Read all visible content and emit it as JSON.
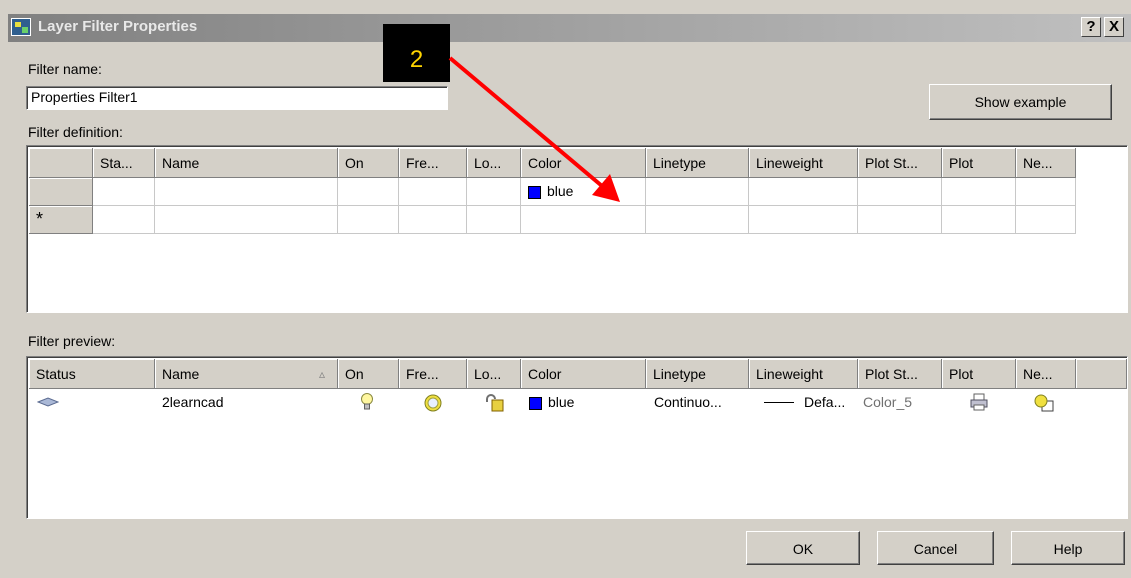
{
  "window": {
    "title": "Layer Filter Properties",
    "help_btn": "?",
    "close_btn": "X"
  },
  "filter_name": {
    "label": "Filter name:",
    "value": "Properties Filter1"
  },
  "show_example_label": "Show example",
  "filter_definition": {
    "label": "Filter definition:",
    "columns": [
      "Sta...",
      "Name",
      "On",
      "Fre...",
      "Lo...",
      "Color",
      "Linetype",
      "Lineweight",
      "Plot St...",
      "Plot",
      "Ne..."
    ],
    "row_color": "blue",
    "new_row_marker": "*"
  },
  "filter_preview": {
    "label": "Filter preview:",
    "columns": [
      "Status",
      "Name",
      "On",
      "Fre...",
      "Lo...",
      "Color",
      "Linetype",
      "Lineweight",
      "Plot St...",
      "Plot",
      "Ne..."
    ],
    "sort_indicator": "▵",
    "row": {
      "name": "2learncad",
      "color": "blue",
      "linetype": "Continuo...",
      "lineweight": "Defa...",
      "plot_style": "Color_5"
    }
  },
  "buttons": {
    "ok": "OK",
    "cancel": "Cancel",
    "help": "Help"
  },
  "callout": {
    "number": "2"
  },
  "colors": {
    "swatch_blue": "#0000ff",
    "arrow_red": "#ff0000",
    "callout_text": "#ffd400"
  },
  "icons": {
    "status": "layer-status-icon",
    "on": "lightbulb-icon",
    "freeze": "sun-icon",
    "lock": "padlock-icon",
    "plot": "printer-icon",
    "new_vp": "new-viewport-freeze-icon"
  }
}
